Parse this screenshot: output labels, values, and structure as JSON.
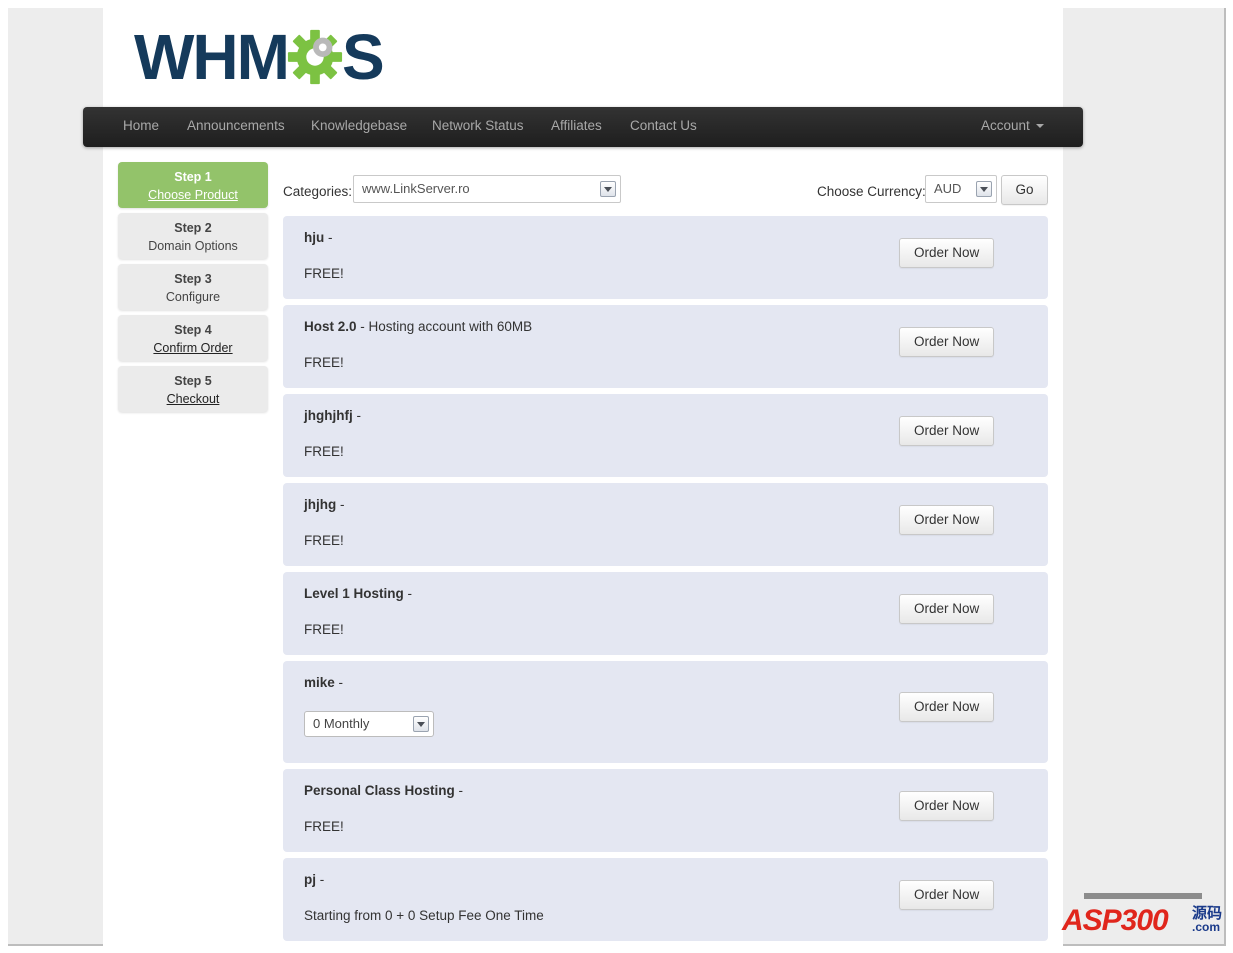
{
  "logo": {
    "text_left": "WHM",
    "text_right": "S"
  },
  "colors": {
    "navbar": "#2b2b2b",
    "active_step": "#93c36a",
    "product_bg": "#e4e7f2",
    "logo_blue": "#153a5b",
    "logo_green": "#7cc242"
  },
  "nav": {
    "items": [
      "Home",
      "Announcements",
      "Knowledgebase",
      "Network Status",
      "Affiliates",
      "Contact Us"
    ],
    "account": "Account"
  },
  "steps": [
    {
      "title": "Step 1",
      "label": "Choose Product",
      "active": true,
      "link": true
    },
    {
      "title": "Step 2",
      "label": "Domain Options",
      "active": false,
      "link": false
    },
    {
      "title": "Step 3",
      "label": "Configure",
      "active": false,
      "link": false
    },
    {
      "title": "Step 4",
      "label": "Confirm Order",
      "active": false,
      "link": true
    },
    {
      "title": "Step 5",
      "label": "Checkout",
      "active": false,
      "link": true
    }
  ],
  "toolbar": {
    "categories_label": "Categories:",
    "category_value": "www.LinkServer.ro",
    "currency_label": "Choose Currency:",
    "currency_value": "AUD",
    "go_button": "Go"
  },
  "order_button": "Order Now",
  "products": [
    {
      "name": "hju",
      "desc": " - ",
      "price": "FREE!"
    },
    {
      "name": "Host 2.0",
      "desc": " - Hosting account with 60MB",
      "price": "FREE!"
    },
    {
      "name": "jhghjhfj",
      "desc": " - ",
      "price": "FREE!"
    },
    {
      "name": "jhjhg",
      "desc": " - ",
      "price": "FREE!"
    },
    {
      "name": "Level 1 Hosting",
      "desc": " - ",
      "price": "FREE!"
    },
    {
      "name": "mike",
      "desc": " - ",
      "cycle": "0 Monthly"
    },
    {
      "name": "Personal Class Hosting",
      "desc": " - ",
      "price": "FREE!"
    },
    {
      "name": "pj",
      "desc": " - ",
      "price": "Starting from 0 + 0 Setup Fee One Time"
    }
  ],
  "watermark": {
    "brand": "ASP300",
    "cn": "源码",
    "com": ".com"
  }
}
